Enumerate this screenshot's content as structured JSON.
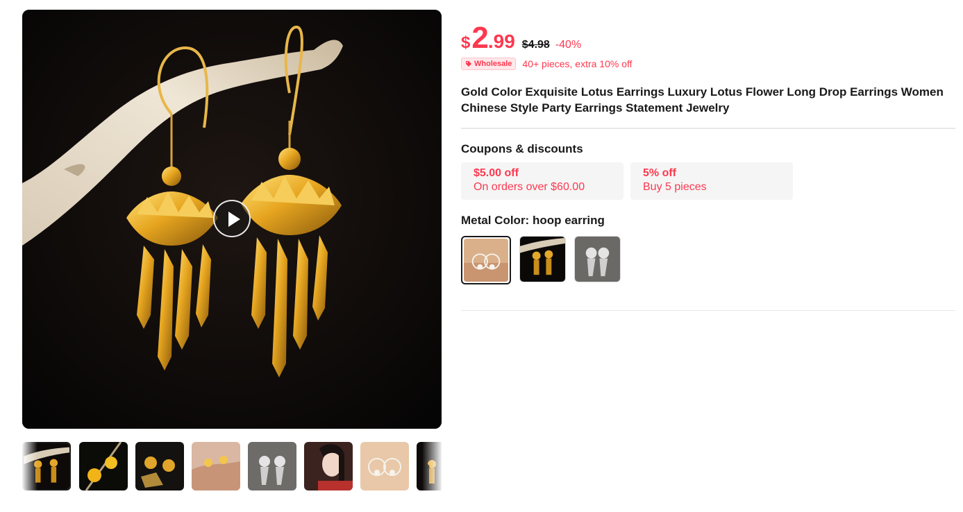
{
  "main_image": {
    "alt": "Gold lotus drop earrings hanging on driftwood",
    "video_available": true
  },
  "thumbnails": [
    {
      "name": "gold-earrings-driftwood",
      "active": true
    },
    {
      "name": "yellow-flower-earrings",
      "active": false
    },
    {
      "name": "gold-leaf-earrings",
      "active": false
    },
    {
      "name": "earrings-held-in-hand",
      "active": false
    },
    {
      "name": "silver-earrings",
      "active": false
    },
    {
      "name": "model-wearing-earrings",
      "active": false
    },
    {
      "name": "hoop-earrings-on-beige",
      "active": false
    },
    {
      "name": "gold-earrings-partial",
      "active": false
    }
  ],
  "price": {
    "currency": "$",
    "integer": "2",
    "decimal": ".99",
    "original": "$4.98",
    "discount": "-40%"
  },
  "wholesale": {
    "badge": "Wholesale",
    "text": "40+ pieces, extra 10% off"
  },
  "product_title": "Gold Color Exquisite Lotus Earrings Luxury Lotus Flower Long Drop Earrings Women Chinese Style Party Earrings Statement Jewelry",
  "coupons": {
    "label": "Coupons & discounts",
    "items": [
      {
        "main": "$5.00 off",
        "sub": "On orders over $60.00"
      },
      {
        "main": "5% off",
        "sub": "Buy 5 pieces"
      }
    ]
  },
  "metal_color": {
    "label": "Metal Color: hoop earring",
    "swatches": [
      {
        "name": "hoop-earring",
        "selected": true
      },
      {
        "name": "gold-lotus",
        "selected": false
      },
      {
        "name": "silver-lotus",
        "selected": false
      }
    ]
  },
  "colors": {
    "accent": "#fd384f",
    "text": "#191919",
    "coupon_bg": "#f5f5f5",
    "divider": "#e8e8e8"
  }
}
